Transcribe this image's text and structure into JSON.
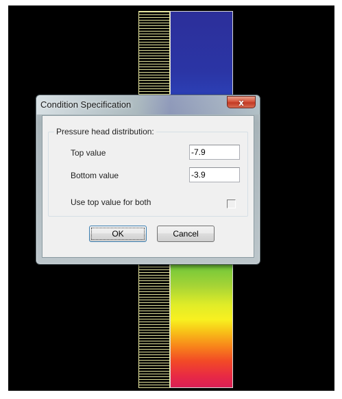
{
  "dialog": {
    "title": "Condition Specification",
    "close_icon": "x",
    "group_label": "Pressure head distribution:",
    "top_value_label": "Top value",
    "top_value": "-7.9",
    "bottom_value_label": "Bottom value",
    "bottom_value": "-3.9",
    "use_top_label": "Use top value for both",
    "use_top_checked": false,
    "ok_label": "OK",
    "cancel_label": "Cancel"
  },
  "colors": {
    "background": "#000000",
    "hatch_line": "#e8e8a0",
    "scale_top": "#2c2f9a",
    "scale_bottom": "#d81f56",
    "close_button": "#c23a24"
  }
}
